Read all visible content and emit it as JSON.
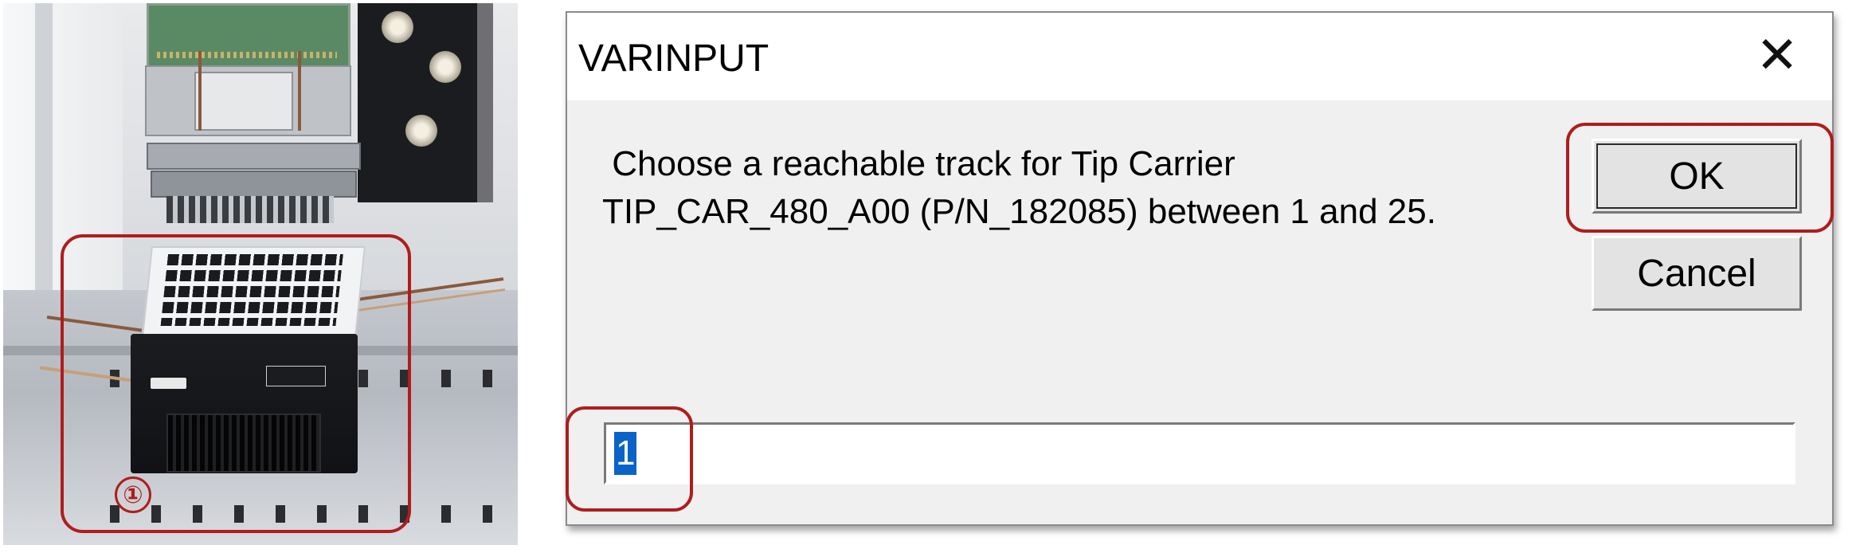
{
  "photo": {
    "callout_number": "①"
  },
  "dialog": {
    "title": "VARINPUT",
    "close_glyph": "✕",
    "message_lines": [
      " Choose a reachable track for Tip Carrier",
      "TIP_CAR_480_A00 (P/N_182085) between 1 and 25."
    ],
    "ok_label": "OK",
    "cancel_label": "Cancel",
    "input_value": "1"
  },
  "colors": {
    "highlight": "#b01c1c",
    "selection": "#0a64c8",
    "dialog_bg": "#f0f0f0"
  }
}
